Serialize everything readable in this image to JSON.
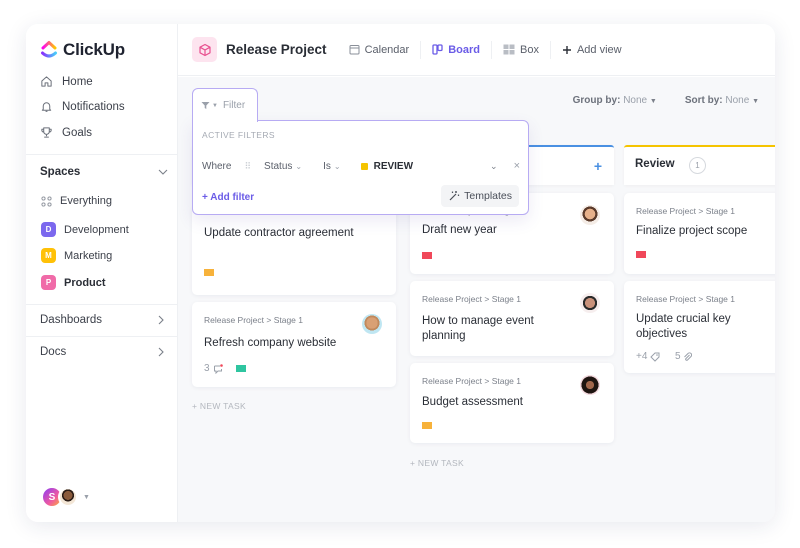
{
  "app": {
    "name": "ClickUp"
  },
  "sidebar": {
    "nav": [
      {
        "label": "Home",
        "icon": "home-icon"
      },
      {
        "label": "Notifications",
        "icon": "bell-icon"
      },
      {
        "label": "Goals",
        "icon": "trophy-icon"
      }
    ],
    "spaces_label": "Spaces",
    "spaces": [
      {
        "label": "Everything",
        "icon": "grid-icon"
      },
      {
        "label": "Development",
        "badge": "D",
        "color": "#7b68ee"
      },
      {
        "label": "Marketing",
        "badge": "M",
        "color": "#ffc107"
      },
      {
        "label": "Product",
        "badge": "P",
        "color": "#f06ba8"
      }
    ],
    "dashboards_label": "Dashboards",
    "docs_label": "Docs",
    "user_initial": "S"
  },
  "header": {
    "project_title": "Release Project",
    "views": [
      {
        "label": "Calendar",
        "icon": "calendar-icon"
      },
      {
        "label": "Board",
        "icon": "board-icon",
        "active": true
      },
      {
        "label": "Box",
        "icon": "box-icon"
      },
      {
        "label": "Add view",
        "icon": "plus-icon"
      }
    ]
  },
  "toolbar": {
    "filter_label": "Filter",
    "group_by_label": "Group by:",
    "group_by_value": "None",
    "sort_by_label": "Sort by:",
    "sort_by_value": "None"
  },
  "filter_popup": {
    "active_filters_label": "ACTIVE FILTERS",
    "where_label": "Where",
    "field": "Status",
    "operator": "Is",
    "value": "REVIEW",
    "value_color": "#f5c400",
    "add_filter_label": "+ Add filter",
    "templates_label": "Templates"
  },
  "columns": [
    {
      "status_color": "#9aa0aa",
      "cards": [
        {
          "breadcrumb": "",
          "title": "Update contractor agreement",
          "flag_color": "#f7b23b"
        },
        {
          "breadcrumb": "Release Project > Stage 1",
          "title": "Refresh company website",
          "comments": "3",
          "flag_color": "#2fc5a0"
        }
      ],
      "new_task_label": "+ NEW TASK"
    },
    {
      "status_color": "#4a90e2",
      "cards": [
        {
          "breadcrumb": "Release Project > Stage 1",
          "title": "Draft new year",
          "flag_color": "#f0485a"
        },
        {
          "breadcrumb": "Release Project > Stage 1",
          "title": "How to manage event planning"
        },
        {
          "breadcrumb": "Release Project > Stage 1",
          "title": "Budget assessment",
          "flag_color": "#f7b23b"
        }
      ],
      "new_task_label": "+ NEW TASK"
    },
    {
      "title": "Review",
      "count": "1",
      "status_color": "#f5c400",
      "cards": [
        {
          "breadcrumb": "Release Project > Stage 1",
          "title": "Finalize project scope",
          "flag_color": "#f0485a"
        },
        {
          "breadcrumb": "Release Project > Stage 1",
          "title": "Update crucial key objectives",
          "tags": "+4",
          "attachments": "5"
        }
      ]
    }
  ]
}
